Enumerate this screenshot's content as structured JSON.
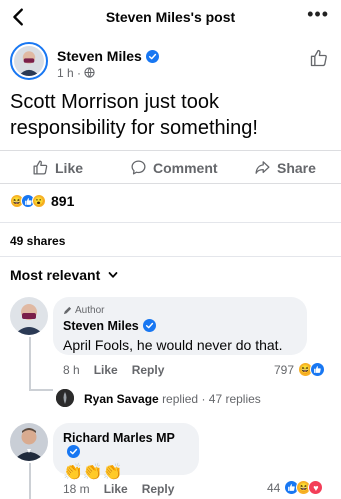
{
  "header": {
    "title": "Steven Miles's post",
    "more_icon": "more-horiz-icon"
  },
  "post": {
    "author": "Steven Miles",
    "time": "1 h",
    "separator": "·",
    "text": "Scott Morrison just took responsibility for something!",
    "actions": {
      "like": "Like",
      "comment": "Comment",
      "share": "Share"
    },
    "reaction_count": "891",
    "reaction_icons": [
      "haha",
      "like",
      "wow"
    ],
    "shares": "49 shares"
  },
  "sort": {
    "label": "Most relevant"
  },
  "comments": [
    {
      "author_tag": "Author",
      "name": "Steven Miles",
      "text": "April Fools, he would never do that.",
      "time": "8 h",
      "like": "Like",
      "reply": "Reply",
      "reaction_count": "797",
      "replies": {
        "name": "Ryan Savage",
        "action": "replied",
        "count": "· 47 replies"
      }
    },
    {
      "name": "Richard Marles MP",
      "text": "👏👏👏",
      "time": "18 m",
      "like": "Like",
      "reply": "Reply",
      "reaction_count": "44"
    }
  ],
  "colors": {
    "facebook_blue": "#1877f2",
    "secondary": "#65676b",
    "bubble": "#f0f2f5"
  }
}
